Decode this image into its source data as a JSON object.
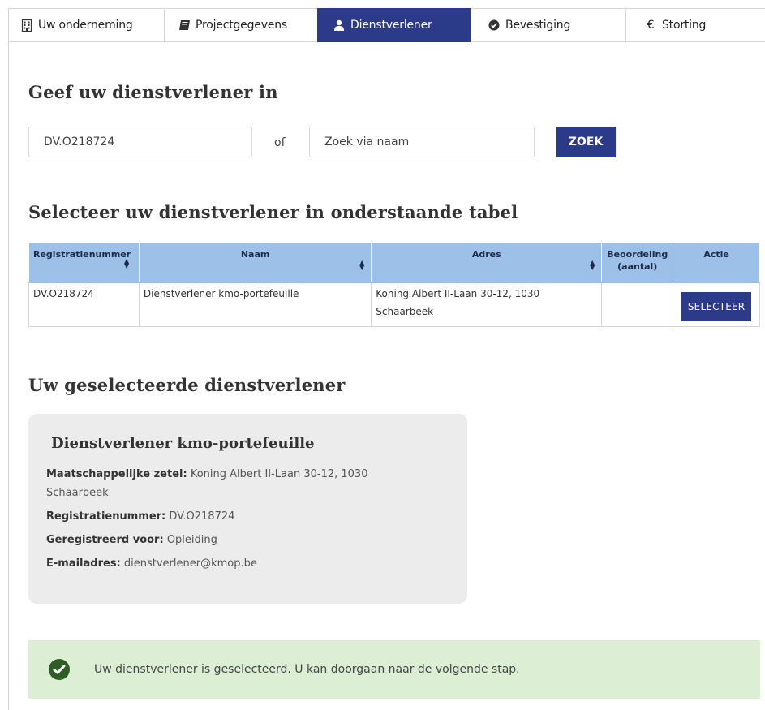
{
  "tabs": [
    {
      "label": "Uw onderneming",
      "icon": "building-icon"
    },
    {
      "label": "Projectgegevens",
      "icon": "book-icon"
    },
    {
      "label": "Dienstverlener",
      "icon": "user-icon",
      "active": true
    },
    {
      "label": "Bevestiging",
      "icon": "check-circle-icon"
    },
    {
      "label": "Storting",
      "icon": "euro-icon"
    }
  ],
  "search": {
    "heading": "Geef uw dienstverlener in",
    "registration_value": "DV.O218724",
    "or_label": "of",
    "name_placeholder": "Zoek via naam",
    "button_label": "ZOEK"
  },
  "table": {
    "heading": "Selecteer uw dienstverlener in onderstaande tabel",
    "columns": {
      "registration": "Registratienummer",
      "name": "Naam",
      "address": "Adres",
      "rating_line1": "Beoordeling",
      "rating_line2": "(aantal)",
      "action": "Actie"
    },
    "rows": [
      {
        "registration": "DV.O218724",
        "name": "Dienstverlener kmo-portefeuille",
        "address_line1": "Koning Albert II-Laan 30-12, 1030",
        "address_line2": "Schaarbeek",
        "rating": "",
        "action_label": "SELECTEER"
      }
    ]
  },
  "selected": {
    "heading": "Uw geselecteerde dienstverlener",
    "name": "Dienstverlener kmo-portefeuille",
    "seat_label": "Maatschappelijke zetel:",
    "seat_line1": "Koning Albert II-Laan 30-12, 1030",
    "seat_line2": "Schaarbeek",
    "reg_label": "Registratienummer:",
    "reg_value": "DV.O218724",
    "registered_for_label": "Geregistreerd voor:",
    "registered_for_value": "Opleiding",
    "email_label": "E-mailadres:",
    "email_value": "dienstverlener@kmop.be"
  },
  "alert": {
    "message": "Uw dienstverlener is geselecteerd. U kan doorgaan naar de volgende stap.",
    "color": "#dcefd5",
    "icon": "check-circle-icon"
  },
  "colors": {
    "primary": "#2c3a8a",
    "table_header": "#9dc0e8"
  }
}
